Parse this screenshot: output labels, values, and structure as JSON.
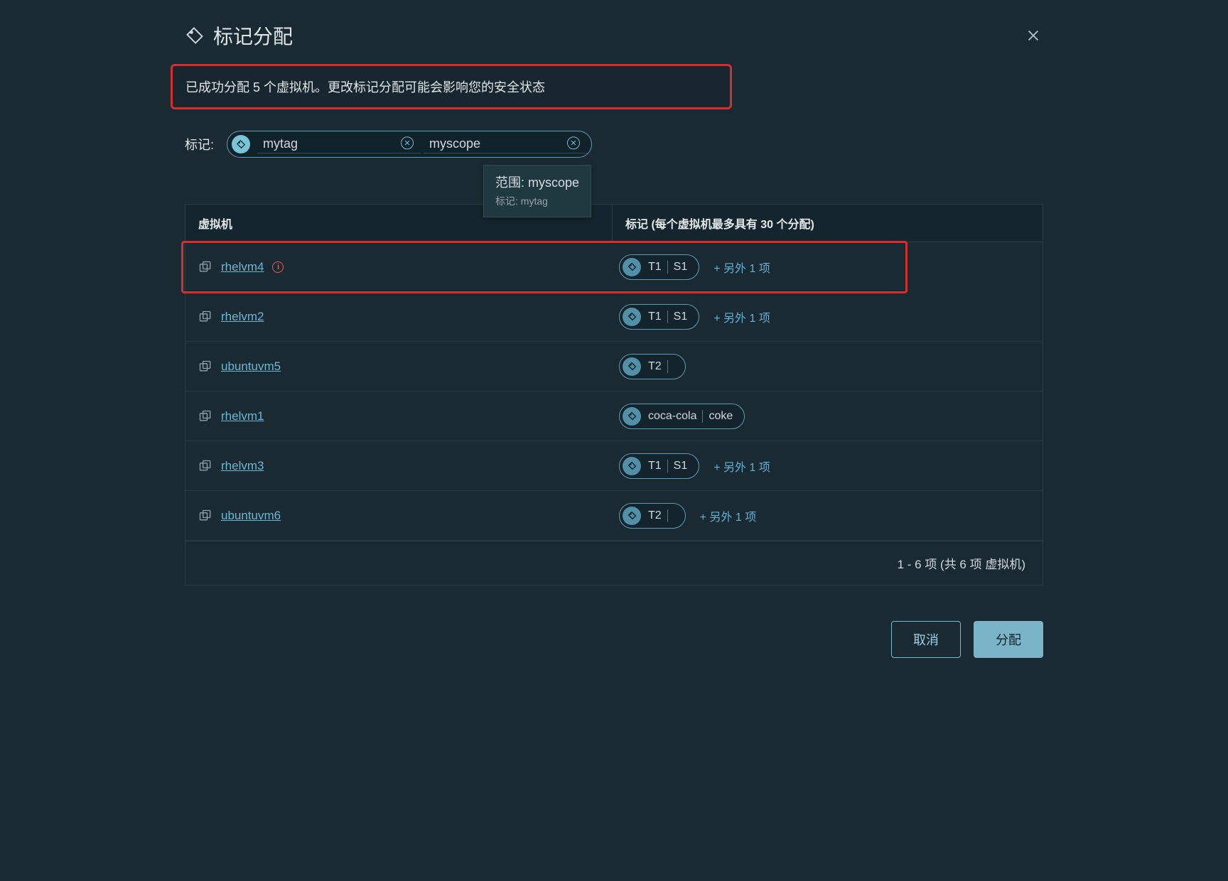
{
  "dialog": {
    "title": "标记分配",
    "alert": "已成功分配 5 个虚拟机。更改标记分配可能会影响您的安全状态",
    "tagLabel": "标记:",
    "tagValue": "mytag",
    "scopeValue": "myscope",
    "tooltip": {
      "line1": "范围: myscope",
      "line2": "标记: mytag"
    },
    "columns": {
      "vm": "虚拟机",
      "tags": "标记 (每个虚拟机最多具有 30 个分配)"
    },
    "moreTemplate": "+ 另外 1 项",
    "pager": "1 - 6 项 (共 6 项 虚拟机)",
    "cancel": "取消",
    "assign": "分配"
  },
  "rows": [
    {
      "name": "rhelvm4",
      "warn": true,
      "highlight": true,
      "chip": [
        "T1",
        "S1"
      ],
      "more": true
    },
    {
      "name": "rhelvm2",
      "warn": false,
      "highlight": false,
      "chip": [
        "T1",
        "S1"
      ],
      "more": true
    },
    {
      "name": "ubuntuvm5",
      "warn": false,
      "highlight": false,
      "chip": [
        "T2",
        ""
      ],
      "more": false
    },
    {
      "name": "rhelvm1",
      "warn": false,
      "highlight": false,
      "chip": [
        "coca-cola",
        "coke"
      ],
      "more": false
    },
    {
      "name": "rhelvm3",
      "warn": false,
      "highlight": false,
      "chip": [
        "T1",
        "S1"
      ],
      "more": true
    },
    {
      "name": "ubuntuvm6",
      "warn": false,
      "highlight": false,
      "chip": [
        "T2",
        ""
      ],
      "more": true
    }
  ]
}
